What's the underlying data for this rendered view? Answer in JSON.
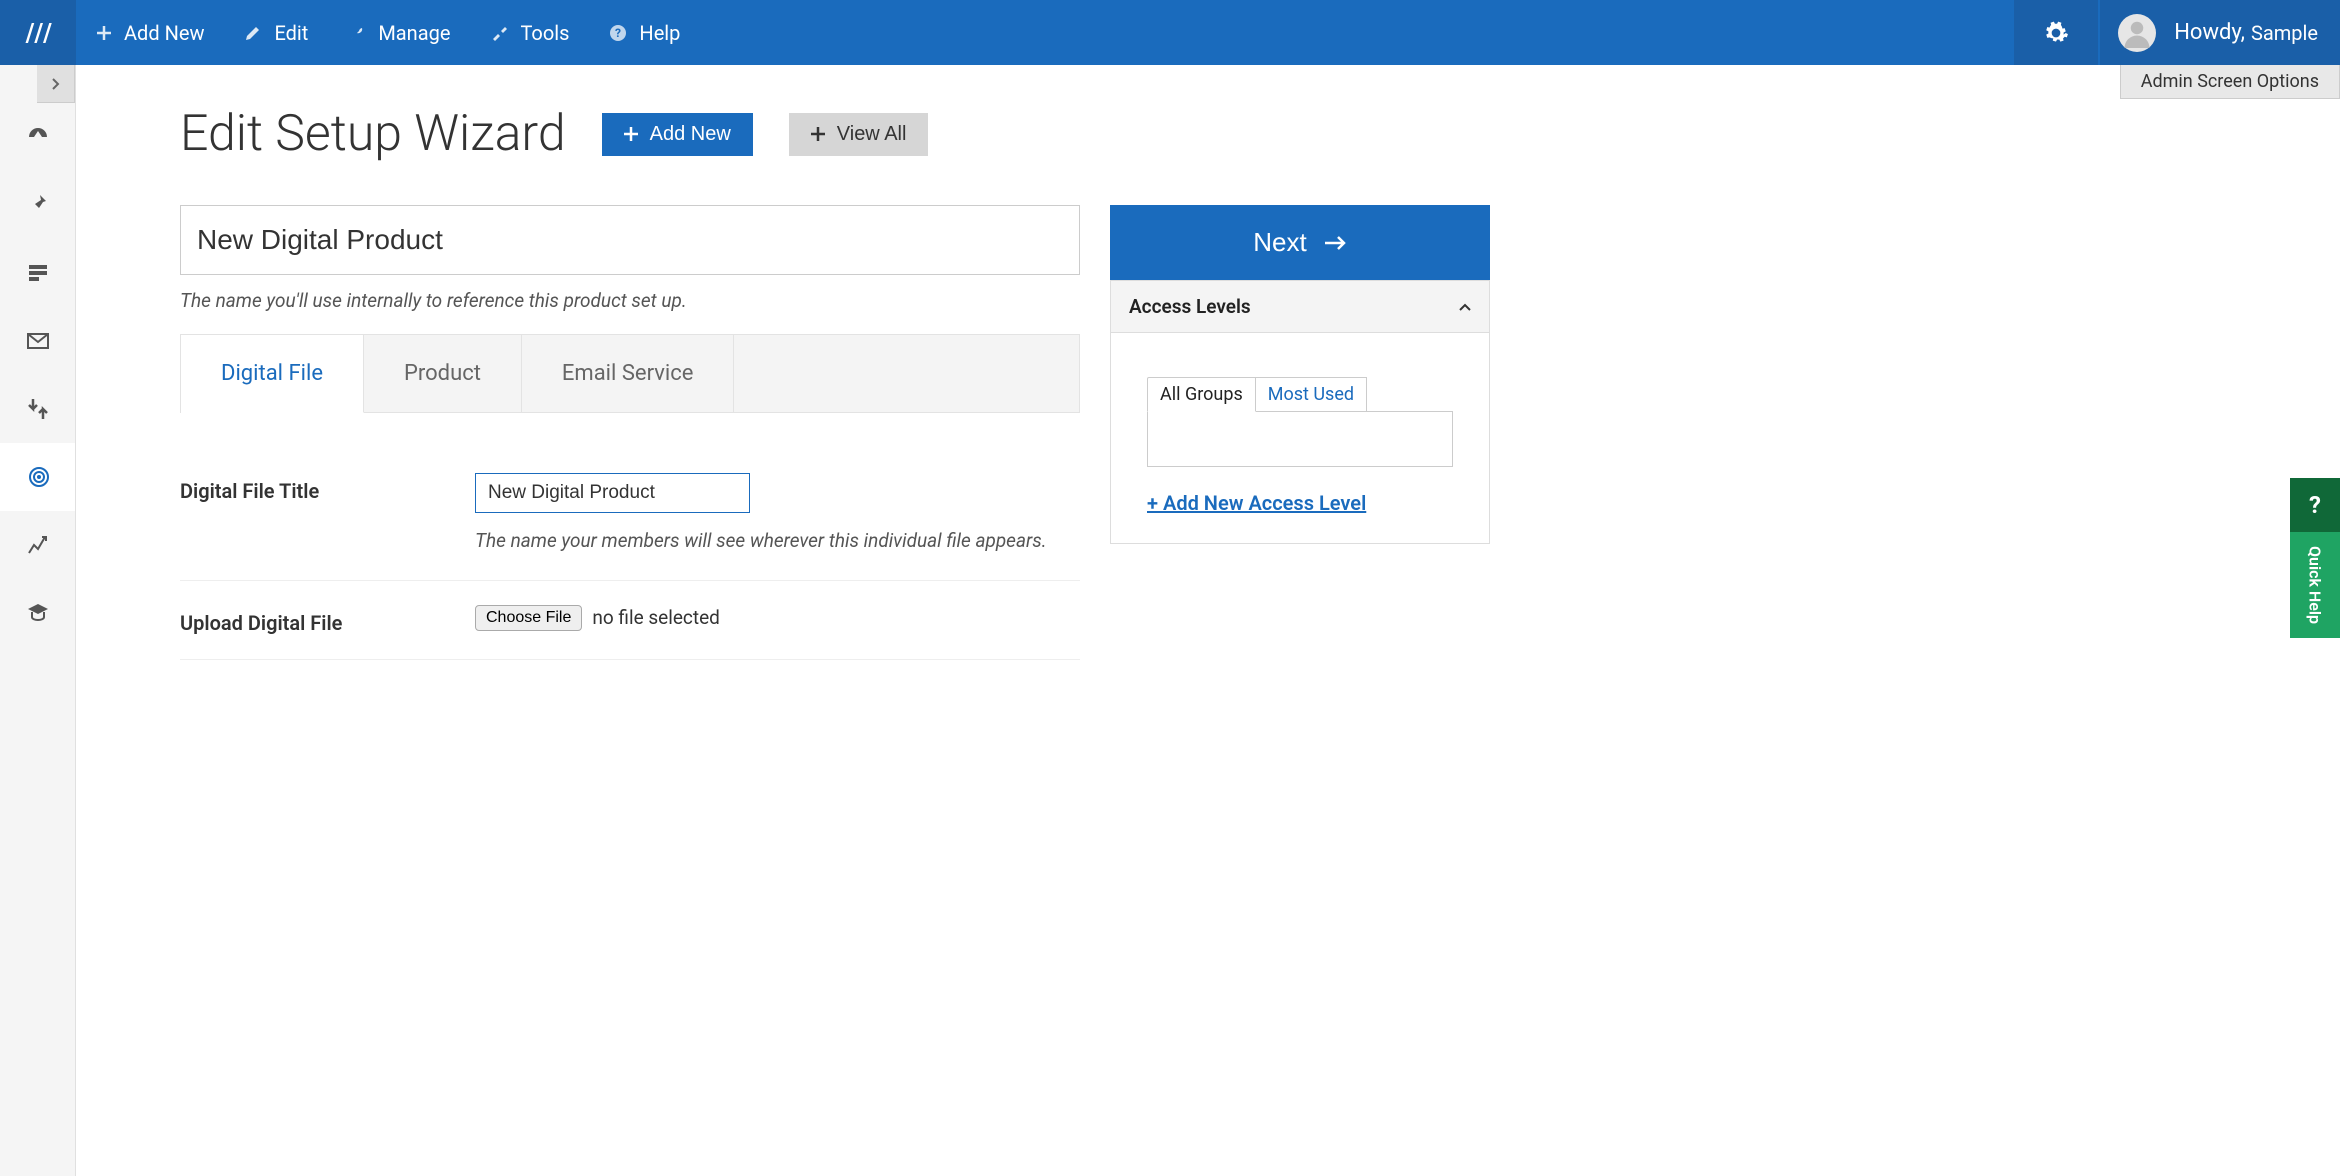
{
  "topnav": {
    "items": [
      {
        "label": "Add New"
      },
      {
        "label": "Edit"
      },
      {
        "label": "Manage"
      },
      {
        "label": "Tools"
      },
      {
        "label": "Help"
      }
    ],
    "greeting": "Howdy,",
    "username": "Sample"
  },
  "screen_options": "Admin Screen Options",
  "page": {
    "title": "Edit Setup Wizard",
    "add_new": "Add New",
    "view_all": "View All"
  },
  "product": {
    "title_value": "New Digital Product",
    "title_hint": "The name you'll use internally to reference this product set up."
  },
  "tabs": [
    {
      "label": "Digital File"
    },
    {
      "label": "Product"
    },
    {
      "label": "Email Service"
    }
  ],
  "form": {
    "file_title_label": "Digital File Title",
    "file_title_value": "New Digital Product",
    "file_title_hint": "The name your members will see wherever this individual file appears.",
    "upload_label": "Upload Digital File",
    "choose_file": "Choose File",
    "no_file": "no file selected"
  },
  "right": {
    "next": "Next",
    "access_levels_title": "Access Levels",
    "subtabs": {
      "all": "All Groups",
      "most": "Most Used"
    },
    "add_access": "+ Add New Access Level"
  },
  "quickhelp": {
    "q": "?",
    "label": "Quick Help"
  }
}
